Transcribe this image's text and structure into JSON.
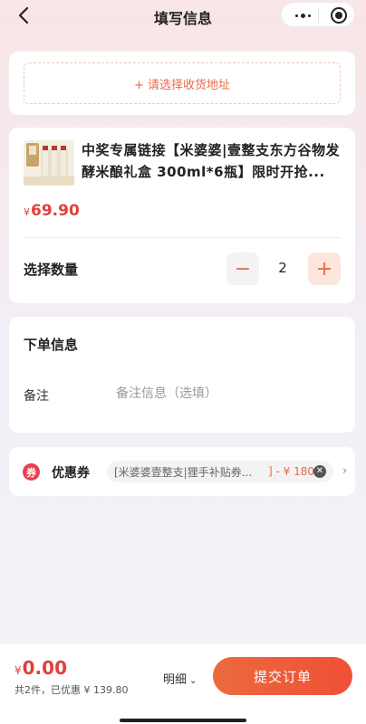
{
  "header": {
    "title": "填写信息",
    "back_icon": "back-arrow-icon",
    "menu_icon": "more-dots-icon",
    "close_icon": "target-circle-icon"
  },
  "address": {
    "add_label": "+ 请选择收货地址"
  },
  "product": {
    "title": "中奖专属链接【米婆婆|壹整支东方谷物发酵米酿礼盒 300ml*6瓶】限时开抢...",
    "currency": "¥",
    "price": "69.90",
    "quantity_label": "选择数量",
    "quantity": "2",
    "minus_label": "−",
    "plus_label": "+"
  },
  "order_info": {
    "title": "下单信息",
    "remark_label": "备注",
    "remark_placeholder": "备注信息（选填）",
    "remark_value": ""
  },
  "coupon": {
    "icon_text": "券",
    "label": "优惠券",
    "name": "[米婆婆壹整支|狸手补贴券...",
    "discount": "] - ¥ 180",
    "clear_icon": "clear-x-icon",
    "arrow": "›"
  },
  "footer": {
    "currency": "¥",
    "total": "0.00",
    "summary": "共2件，已优惠 ¥ 139.80",
    "detail_label": "明细",
    "detail_chevron": "⌄",
    "submit_label": "提交订单"
  },
  "colors": {
    "accent": "#e86a46",
    "price": "#e0403a",
    "submit_start": "#ec6a3e",
    "submit_end": "#ef4f36"
  }
}
